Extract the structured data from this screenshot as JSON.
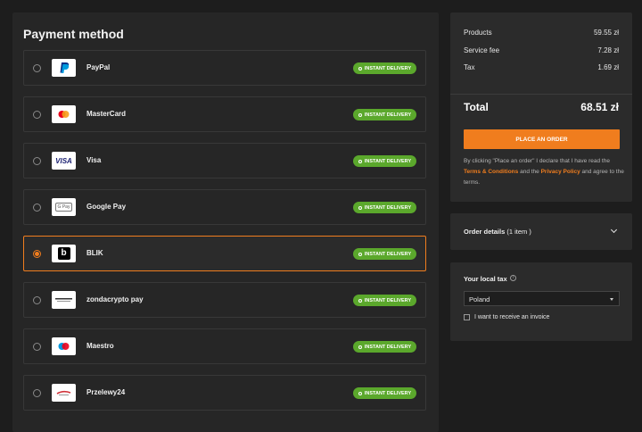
{
  "payment": {
    "title": "Payment method",
    "badge_label": "INSTANT DELIVERY",
    "methods": [
      {
        "name": "PayPal",
        "icon": "paypal-logo",
        "selected": false
      },
      {
        "name": "MasterCard",
        "icon": "mastercard-logo",
        "selected": false
      },
      {
        "name": "Visa",
        "icon": "visa-logo",
        "selected": false
      },
      {
        "name": "Google Pay",
        "icon": "google-pay-logo",
        "selected": false
      },
      {
        "name": "BLIK",
        "icon": "blik-logo",
        "selected": true
      },
      {
        "name": "zondacrypto pay",
        "icon": "zondacrypto-logo",
        "selected": false
      },
      {
        "name": "Maestro",
        "icon": "maestro-logo",
        "selected": false
      },
      {
        "name": "Przelewy24",
        "icon": "przelewy24-logo",
        "selected": false
      }
    ],
    "logo_texts": {
      "visa": "VISA",
      "gpay": "G Pay",
      "blik": "b"
    }
  },
  "summary": {
    "products_label": "Products",
    "products_value": "59.55 zł",
    "fee_label": "Service fee",
    "fee_value": "7.28 zł",
    "tax_label": "Tax",
    "tax_value": "1.69 zł",
    "total_label": "Total",
    "total_value": "68.51 zł",
    "order_button": "PLACE AN ORDER",
    "terms_pre": "By clicking \"Place an order\" I declare that I have read the ",
    "terms_link": "Terms & Conditions",
    "terms_mid": " and the ",
    "privacy_link": "Privacy Policy",
    "terms_post": " and agree to the terms."
  },
  "details": {
    "label": "Order details",
    "count": "(1 item )"
  },
  "tax": {
    "title": "Your local tax",
    "country": "Poland",
    "invoice_label": "I want to receive an invoice"
  },
  "colors": {
    "accent": "#f07d1e",
    "badge": "#5ba82c",
    "panel": "#262626",
    "background": "#1d1d1d"
  }
}
